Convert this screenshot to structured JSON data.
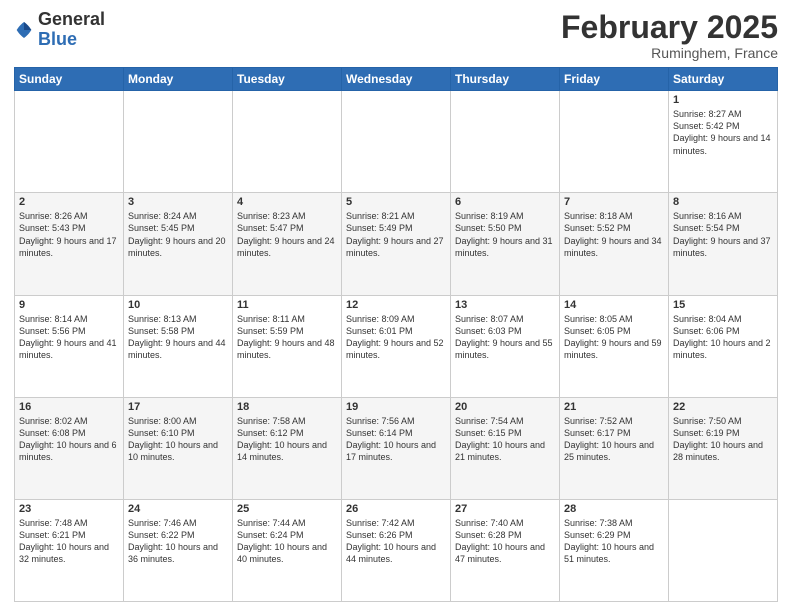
{
  "header": {
    "logo_general": "General",
    "logo_blue": "Blue",
    "month": "February 2025",
    "location": "Ruminghem, France"
  },
  "days_of_week": [
    "Sunday",
    "Monday",
    "Tuesday",
    "Wednesday",
    "Thursday",
    "Friday",
    "Saturday"
  ],
  "weeks": [
    [
      {
        "day": "",
        "info": ""
      },
      {
        "day": "",
        "info": ""
      },
      {
        "day": "",
        "info": ""
      },
      {
        "day": "",
        "info": ""
      },
      {
        "day": "",
        "info": ""
      },
      {
        "day": "",
        "info": ""
      },
      {
        "day": "1",
        "info": "Sunrise: 8:27 AM\nSunset: 5:42 PM\nDaylight: 9 hours and 14 minutes."
      }
    ],
    [
      {
        "day": "2",
        "info": "Sunrise: 8:26 AM\nSunset: 5:43 PM\nDaylight: 9 hours and 17 minutes."
      },
      {
        "day": "3",
        "info": "Sunrise: 8:24 AM\nSunset: 5:45 PM\nDaylight: 9 hours and 20 minutes."
      },
      {
        "day": "4",
        "info": "Sunrise: 8:23 AM\nSunset: 5:47 PM\nDaylight: 9 hours and 24 minutes."
      },
      {
        "day": "5",
        "info": "Sunrise: 8:21 AM\nSunset: 5:49 PM\nDaylight: 9 hours and 27 minutes."
      },
      {
        "day": "6",
        "info": "Sunrise: 8:19 AM\nSunset: 5:50 PM\nDaylight: 9 hours and 31 minutes."
      },
      {
        "day": "7",
        "info": "Sunrise: 8:18 AM\nSunset: 5:52 PM\nDaylight: 9 hours and 34 minutes."
      },
      {
        "day": "8",
        "info": "Sunrise: 8:16 AM\nSunset: 5:54 PM\nDaylight: 9 hours and 37 minutes."
      }
    ],
    [
      {
        "day": "9",
        "info": "Sunrise: 8:14 AM\nSunset: 5:56 PM\nDaylight: 9 hours and 41 minutes."
      },
      {
        "day": "10",
        "info": "Sunrise: 8:13 AM\nSunset: 5:58 PM\nDaylight: 9 hours and 44 minutes."
      },
      {
        "day": "11",
        "info": "Sunrise: 8:11 AM\nSunset: 5:59 PM\nDaylight: 9 hours and 48 minutes."
      },
      {
        "day": "12",
        "info": "Sunrise: 8:09 AM\nSunset: 6:01 PM\nDaylight: 9 hours and 52 minutes."
      },
      {
        "day": "13",
        "info": "Sunrise: 8:07 AM\nSunset: 6:03 PM\nDaylight: 9 hours and 55 minutes."
      },
      {
        "day": "14",
        "info": "Sunrise: 8:05 AM\nSunset: 6:05 PM\nDaylight: 9 hours and 59 minutes."
      },
      {
        "day": "15",
        "info": "Sunrise: 8:04 AM\nSunset: 6:06 PM\nDaylight: 10 hours and 2 minutes."
      }
    ],
    [
      {
        "day": "16",
        "info": "Sunrise: 8:02 AM\nSunset: 6:08 PM\nDaylight: 10 hours and 6 minutes."
      },
      {
        "day": "17",
        "info": "Sunrise: 8:00 AM\nSunset: 6:10 PM\nDaylight: 10 hours and 10 minutes."
      },
      {
        "day": "18",
        "info": "Sunrise: 7:58 AM\nSunset: 6:12 PM\nDaylight: 10 hours and 14 minutes."
      },
      {
        "day": "19",
        "info": "Sunrise: 7:56 AM\nSunset: 6:14 PM\nDaylight: 10 hours and 17 minutes."
      },
      {
        "day": "20",
        "info": "Sunrise: 7:54 AM\nSunset: 6:15 PM\nDaylight: 10 hours and 21 minutes."
      },
      {
        "day": "21",
        "info": "Sunrise: 7:52 AM\nSunset: 6:17 PM\nDaylight: 10 hours and 25 minutes."
      },
      {
        "day": "22",
        "info": "Sunrise: 7:50 AM\nSunset: 6:19 PM\nDaylight: 10 hours and 28 minutes."
      }
    ],
    [
      {
        "day": "23",
        "info": "Sunrise: 7:48 AM\nSunset: 6:21 PM\nDaylight: 10 hours and 32 minutes."
      },
      {
        "day": "24",
        "info": "Sunrise: 7:46 AM\nSunset: 6:22 PM\nDaylight: 10 hours and 36 minutes."
      },
      {
        "day": "25",
        "info": "Sunrise: 7:44 AM\nSunset: 6:24 PM\nDaylight: 10 hours and 40 minutes."
      },
      {
        "day": "26",
        "info": "Sunrise: 7:42 AM\nSunset: 6:26 PM\nDaylight: 10 hours and 44 minutes."
      },
      {
        "day": "27",
        "info": "Sunrise: 7:40 AM\nSunset: 6:28 PM\nDaylight: 10 hours and 47 minutes."
      },
      {
        "day": "28",
        "info": "Sunrise: 7:38 AM\nSunset: 6:29 PM\nDaylight: 10 hours and 51 minutes."
      },
      {
        "day": "",
        "info": ""
      }
    ]
  ]
}
